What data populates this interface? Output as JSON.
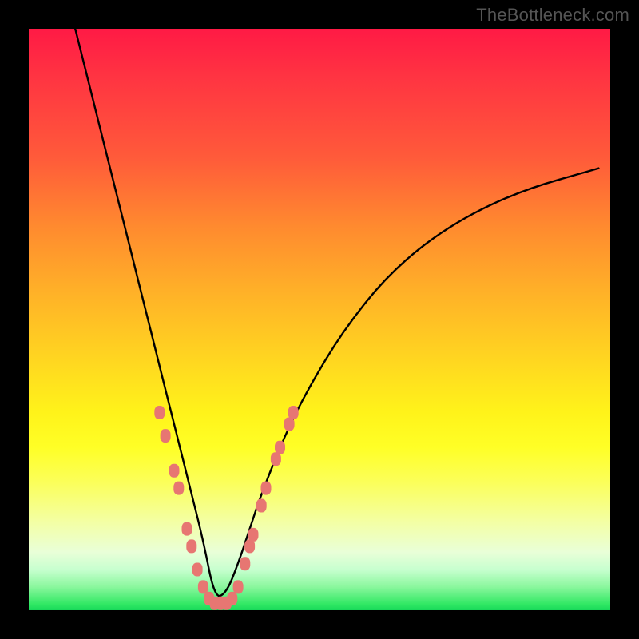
{
  "watermark": "TheBottleneck.com",
  "colors": {
    "curve_stroke": "#000000",
    "dot_fill": "#e77672",
    "frame_bg": "#000000"
  },
  "chart_data": {
    "type": "line",
    "title": "",
    "xlabel": "",
    "ylabel": "",
    "xlim": [
      0,
      100
    ],
    "ylim": [
      0,
      100
    ],
    "note": "No axis ticks or numeric labels are rendered in the image; x/y values below are estimated in percent of the visible plot area (0,0 = bottom-left, 100,100 = top-right). The V-shaped curve reaches ~0 at x≈32.",
    "series": [
      {
        "name": "bottleneck-curve",
        "x": [
          8,
          10,
          12,
          14,
          16,
          18,
          20,
          22,
          24,
          26,
          28,
          30,
          32,
          34,
          36,
          38,
          40,
          44,
          48,
          54,
          62,
          72,
          84,
          98
        ],
        "y": [
          100,
          92,
          84,
          76,
          68,
          60,
          52,
          44,
          36,
          28,
          20,
          12,
          2,
          3,
          8,
          14,
          20,
          30,
          38,
          48,
          58,
          66,
          72,
          76
        ]
      }
    ],
    "highlight_dots": {
      "name": "highlighted-range",
      "points": [
        {
          "x": 22.5,
          "y": 34
        },
        {
          "x": 23.5,
          "y": 30
        },
        {
          "x": 25.0,
          "y": 24
        },
        {
          "x": 25.8,
          "y": 21
        },
        {
          "x": 27.2,
          "y": 14
        },
        {
          "x": 28.0,
          "y": 11
        },
        {
          "x": 29.0,
          "y": 7
        },
        {
          "x": 30.0,
          "y": 4
        },
        {
          "x": 31.0,
          "y": 2
        },
        {
          "x": 32.0,
          "y": 1.2
        },
        {
          "x": 33.0,
          "y": 1.2
        },
        {
          "x": 34.0,
          "y": 1.2
        },
        {
          "x": 35.0,
          "y": 2
        },
        {
          "x": 36.0,
          "y": 4
        },
        {
          "x": 37.2,
          "y": 8
        },
        {
          "x": 38.0,
          "y": 11
        },
        {
          "x": 38.6,
          "y": 13
        },
        {
          "x": 40.0,
          "y": 18
        },
        {
          "x": 40.8,
          "y": 21
        },
        {
          "x": 42.5,
          "y": 26
        },
        {
          "x": 43.2,
          "y": 28
        },
        {
          "x": 44.8,
          "y": 32
        },
        {
          "x": 45.5,
          "y": 34
        }
      ]
    }
  }
}
